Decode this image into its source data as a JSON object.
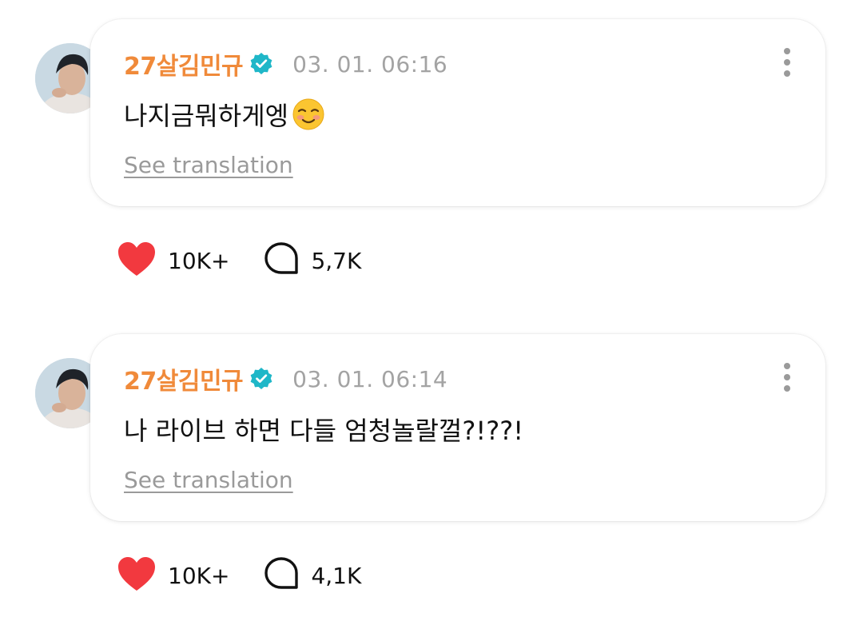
{
  "posts": [
    {
      "author": "27살김민규",
      "timestamp": "03. 01. 06:16",
      "message": "나지금뭐하게엥",
      "emoji": "smiling-face-emoji",
      "translate_label": "See translation",
      "likes": "10K+",
      "comments": "5,7K"
    },
    {
      "author": "27살김민규",
      "timestamp": "03. 01. 06:14",
      "message": "나 라이브 하면 다들 엄청놀랄껄?!??!",
      "translate_label": "See translation",
      "likes": "10K+",
      "comments": "4,1K"
    }
  ],
  "colors": {
    "author": "#f08a3a",
    "verified": "#1fb7c8",
    "like": "#f2393f",
    "muted": "#9a9a9a"
  },
  "icons": {
    "verified": "verified-badge-icon",
    "more": "more-vertical-icon",
    "like": "heart-icon",
    "comment": "comment-bubble-icon"
  }
}
